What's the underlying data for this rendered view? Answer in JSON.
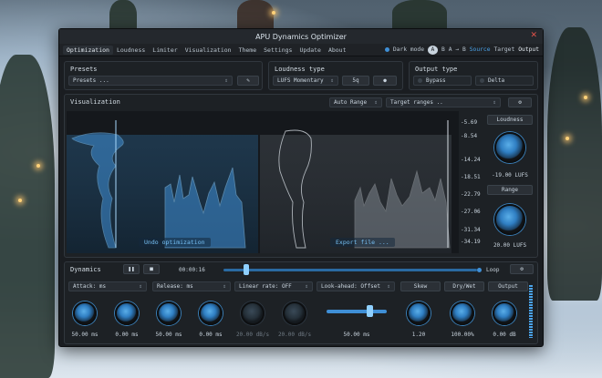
{
  "window": {
    "title": "APU Dynamics Optimizer",
    "close_icon": "close-icon"
  },
  "menu": {
    "items": [
      "Optimization",
      "Loudness",
      "Limiter",
      "Visualization",
      "Theme",
      "Settings",
      "Update",
      "About"
    ],
    "dark_mode": "Dark mode",
    "ab": [
      "A",
      "B",
      "A → B"
    ],
    "monitor": [
      "Source",
      "Target",
      "Output"
    ]
  },
  "presets": {
    "title": "Presets",
    "value": "Presets ..."
  },
  "loudness_type": {
    "title": "Loudness type",
    "value": "LUFS Momentary",
    "btn1": "5q"
  },
  "output_type": {
    "title": "Output type",
    "options": [
      "Bypass",
      "Delta"
    ]
  },
  "visualization": {
    "title": "Visualization",
    "range_select": "Auto Range",
    "target_select": "Target ranges ..",
    "ticks": [
      "-5.69",
      "-8.54",
      "-14.24",
      "-18.51",
      "-22.79",
      "-27.06",
      "-31.34",
      "-34.19"
    ],
    "undo_button": "Undo optimization",
    "export_button": "Export file ...",
    "loudness_label": "Loudness",
    "loudness_value": "-19.00 LUFS",
    "range_label": "Range",
    "range_value": "20.00 LUFS"
  },
  "dynamics": {
    "title": "Dynamics",
    "time": "00:00:16",
    "loop_label": "Loop",
    "controls": [
      "Attack: ms",
      "Release: ms",
      "Linear rate: OFF",
      "Look-ahead: Offset",
      "Skew",
      "Dry/Wet",
      "Output"
    ],
    "knob_values": [
      "50.00 ms",
      "0.00 ms",
      "50.00 ms",
      "0.00 ms",
      "20.00 dB/s",
      "20.00 dB/s",
      "50.00 ms",
      "1.20",
      "100.00%",
      "0.00 dB"
    ]
  },
  "colors": {
    "accent": "#3f8fd6",
    "panel": "#1d2125",
    "close": "#e2524a"
  }
}
